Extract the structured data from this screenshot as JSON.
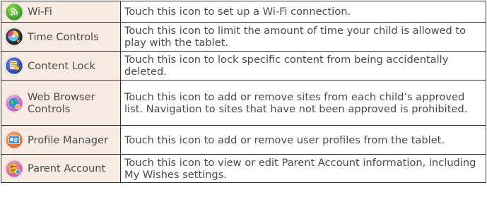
{
  "rows": [
    {
      "name": "Wi-Fi",
      "icon": "wifi-icon",
      "description": "Touch this icon to set up a  Wi-Fi connection."
    },
    {
      "name": "Time Controls",
      "icon": "time-controls-icon",
      "description": "Touch this icon to limit the amount of time your child is allowed to play with the tablet."
    },
    {
      "name": "Content Lock",
      "icon": "content-lock-icon",
      "description": "Touch this icon to lock specific content from being accidentally deleted."
    },
    {
      "name": "Web Browser Controls",
      "icon": "web-browser-controls-icon",
      "description": "Touch this icon to add or remove sites from each child’s approved list. Navigation to sites that have not been approved is prohibited."
    },
    {
      "name": "Profile Manager",
      "icon": "profile-manager-icon",
      "description": "Touch this icon to add or remove user profiles from the tablet."
    },
    {
      "name": "Parent Account",
      "icon": "parent-account-icon",
      "description": "Touch this icon to view or edit Parent Account information, including My Wishes settings."
    }
  ],
  "colors": {
    "name_cell_background": "#f7ebe2",
    "border": "#333333",
    "text": "#4a4a4a"
  }
}
